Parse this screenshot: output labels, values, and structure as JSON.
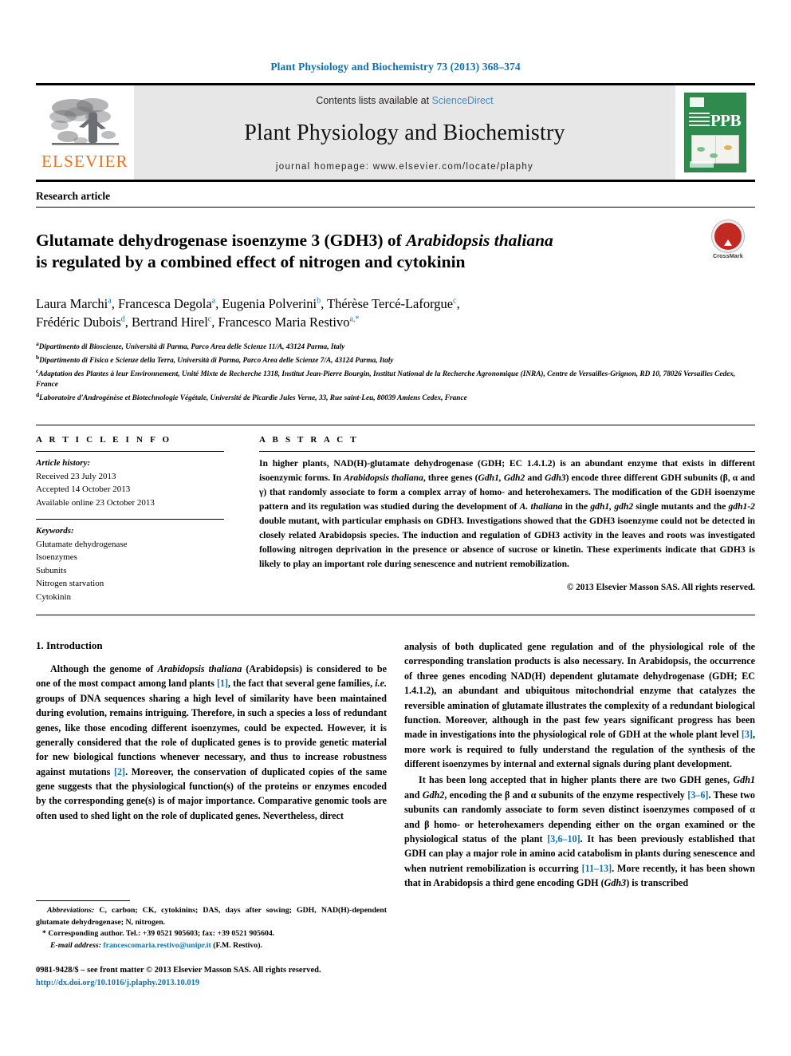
{
  "running_head": "Plant Physiology and Biochemistry 73 (2013) 368–374",
  "masthead": {
    "contents_prefix": "Contents lists available at ",
    "sciencedirect": "ScienceDirect",
    "journal_name": "Plant Physiology and Biochemistry",
    "homepage": "journal homepage: www.elsevier.com/locate/plaphy",
    "publisher_logo_text": "ELSEVIER",
    "cover_abbrev": "PPB",
    "accent_blue": "#0b72b5",
    "elsevier_orange": "#E9711C",
    "cover_green": "#2f8a4e"
  },
  "article": {
    "category": "Research article",
    "title_line1_a": "Glutamate dehydrogenase isoenzyme 3 (GDH3) of ",
    "title_line1_italic": "Arabidopsis thaliana",
    "title_line2": "is regulated by a combined effect of nitrogen and cytokinin",
    "crossmark_label": "CrossMark",
    "authors": [
      {
        "name": "Laura Marchi",
        "sup": "a",
        "sep": ", "
      },
      {
        "name": "Francesca Degola",
        "sup": "a",
        "sep": ", "
      },
      {
        "name": "Eugenia Polverini",
        "sup": "b",
        "sep": ", "
      },
      {
        "name": "Thérèse Tercé-Laforgue",
        "sup": "c",
        "sep": ","
      },
      {
        "name": "Frédéric Dubois",
        "sup": "d",
        "sep": ", "
      },
      {
        "name": "Bertrand Hirel",
        "sup": "c",
        "sep": ", "
      },
      {
        "name": "Francesco Maria Restivo",
        "sup": "a,*",
        "sep": ""
      }
    ],
    "affiliations": [
      {
        "mark": "a",
        "text": "Dipartimento di Bioscienze, Università di Parma, Parco Area delle Scienze 11/A, 43124 Parma, Italy"
      },
      {
        "mark": "b",
        "text": "Dipartimento di Fisica e Scienze della Terra, Università di Parma, Parco Area delle Scienze 7/A, 43124 Parma, Italy"
      },
      {
        "mark": "c",
        "text": "Adaptation des Plantes à leur Environnement, Unité Mixte de Recherche 1318, Institut Jean-Pierre Bourgin, Institut National de la Recherche Agronomique (INRA), Centre de Versailles-Grignon, RD 10, 78026 Versailles Cedex, France"
      },
      {
        "mark": "d",
        "text": "Laboratoire d'Androgénèse et Biotechnologie Végétale, Université de Picardie Jules Verne, 33, Rue saint-Leu, 80039 Amiens Cedex, France"
      }
    ]
  },
  "article_info": {
    "heading": "A R T I C L E   I N F O",
    "history_label": "Article history:",
    "received": "Received 23 July 2013",
    "accepted": "Accepted 14 October 2013",
    "available": "Available online 23 October 2013",
    "keywords_label": "Keywords:",
    "keywords": [
      "Glutamate dehydrogenase",
      "Isoenzymes",
      "Subunits",
      "Nitrogen starvation",
      "Cytokinin"
    ]
  },
  "abstract": {
    "heading": "A B S T R A C T",
    "p1_seg1": "In higher plants, NAD(H)-glutamate dehydrogenase (GDH; EC 1.4.1.2) is an abundant enzyme that exists in different isoenzymic forms. In ",
    "p1_italic1": "Arabidopsis thaliana",
    "p1_seg2": ", three genes (",
    "p1_italic2": "Gdh1, Gdh2",
    "p1_seg3": " and ",
    "p1_italic3": "Gdh3",
    "p1_seg4": ") encode three different GDH subunits (β, α and γ) that randomly associate to form a complex array of homo- and heterohexamers. The modification of the GDH isoenzyme pattern and its regulation was studied during the development of ",
    "p1_italic4": "A. thaliana",
    "p1_seg5": " in the ",
    "p1_italic5": "gdh1, gdh2",
    "p1_seg6": " single mutants and the ",
    "p1_italic6": "gdh1-2",
    "p1_seg7": " double mutant, with particular emphasis on GDH3. Investigations showed that the GDH3 isoenzyme could not be detected in closely related Arabidopsis species. The induction and regulation of GDH3 activity in the leaves and roots was investigated following nitrogen deprivation in the presence or absence of sucrose or kinetin. These experiments indicate that GDH3 is likely to play an important role during senescence and nutrient remobilization.",
    "copyright": "© 2013 Elsevier Masson SAS. All rights reserved."
  },
  "introduction": {
    "heading": "1.  Introduction",
    "left_p1_seg1": "Although the genome of ",
    "left_p1_italic1": "Arabidopsis thaliana",
    "left_p1_seg2": " (Arabidopsis) is considered to be one of the most compact among land plants ",
    "left_p1_ref1": "[1]",
    "left_p1_seg3": ", the fact that several gene families, ",
    "left_p1_italic2": "i.e.",
    "left_p1_seg4": " groups of DNA sequences sharing a high level of similarity have been maintained during evolution, remains intriguing. Therefore, in such a species a loss of redundant genes, like those encoding different isoenzymes, could be expected. However, it is generally considered that the role of duplicated genes is to provide genetic material for new biological functions whenever necessary, and thus to increase robustness against mutations ",
    "left_p1_ref2": "[2]",
    "left_p1_seg5": ". Moreover, the conservation of duplicated copies of the same gene suggests that the physiological function(s) of the proteins or enzymes encoded by the corresponding gene(s) is of major importance. Comparative genomic tools are often used to shed light on the role of duplicated genes. Nevertheless, direct",
    "right_p1_seg1": "analysis of both duplicated gene regulation and of the physiological role of the corresponding translation products is also necessary. In Arabidopsis, the occurrence of three genes encoding NAD(H) dependent glutamate dehydrogenase (GDH; EC 1.4.1.2), an abundant and ubiquitous mitochondrial enzyme that catalyzes the reversible amination of glutamate illustrates the complexity of a redundant biological function. Moreover, although in the past few years significant progress has been made in investigations into the physiological role of GDH at the whole plant level ",
    "right_p1_ref1": "[3]",
    "right_p1_seg2": ", more work is required to fully understand the regulation of the synthesis of the different isoenzymes by internal and external signals during plant development.",
    "right_p2_seg1": "It has been long accepted that in higher plants there are two GDH genes, ",
    "right_p2_italic1": "Gdh1",
    "right_p2_seg2": " and ",
    "right_p2_italic2": "Gdh2",
    "right_p2_seg3": ", encoding the β and α subunits of the enzyme respectively ",
    "right_p2_ref1": "[3–6]",
    "right_p2_seg4": ". These two subunits can randomly associate to form seven distinct isoenzymes composed of α and β homo- or heterohexamers depending either on the organ examined or the physiological status of the plant ",
    "right_p2_ref2": "[3,6–10]",
    "right_p2_seg5": ". It has been previously established that GDH can play a major role in amino acid catabolism in plants during senescence and when nutrient remobilization is occurring ",
    "right_p2_ref3": "[11–13]",
    "right_p2_seg6": ". More recently, it has been shown that in Arabidopsis a third gene encoding GDH (",
    "right_p2_italic3": "Gdh3",
    "right_p2_seg7": ") is transcribed"
  },
  "footnotes": {
    "abbrev_label": "Abbreviations:",
    "abbrev_text": " C, carbon; CK, cytokinins; DAS, days after sowing; GDH, NAD(H)-dependent glutamate dehydrogenase; N, nitrogen.",
    "corresponding": "* Corresponding author. Tel.: +39 0521 905603; fax: +39 0521 905604.",
    "email_label": "E-mail address:",
    "email": "francescomaria.restivo@unipr.it",
    "email_owner": " (F.M. Restivo)."
  },
  "bottom": {
    "issn_line": "0981-9428/$ – see front matter © 2013 Elsevier Masson SAS. All rights reserved.",
    "doi": "http://dx.doi.org/10.1016/j.plaphy.2013.10.019"
  }
}
